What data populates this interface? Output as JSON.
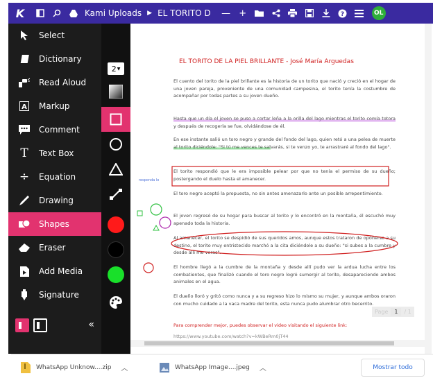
{
  "topbar": {
    "logo": "K",
    "folder": "Kami Uploads",
    "doc_title": "EL TORITO D",
    "avatar": "OL"
  },
  "sidebar": {
    "items": [
      {
        "label": "Select",
        "icon": "cursor-icon"
      },
      {
        "label": "Dictionary",
        "icon": "book-icon"
      },
      {
        "label": "Read Aloud",
        "icon": "read-aloud-icon"
      },
      {
        "label": "Markup",
        "icon": "markup-icon"
      },
      {
        "label": "Comment",
        "icon": "comment-icon"
      },
      {
        "label": "Text Box",
        "icon": "text-box-icon"
      },
      {
        "label": "Equation",
        "icon": "equation-icon"
      },
      {
        "label": "Drawing",
        "icon": "pen-icon"
      },
      {
        "label": "Shapes",
        "icon": "shapes-icon"
      },
      {
        "label": "Eraser",
        "icon": "eraser-icon"
      },
      {
        "label": "Add Media",
        "icon": "media-icon"
      },
      {
        "label": "Signature",
        "icon": "signature-icon"
      }
    ],
    "active": "Shapes"
  },
  "palette": {
    "size_value": "2",
    "colors": [
      "#ff1a1a",
      "#000000",
      "#19e02a"
    ]
  },
  "document": {
    "heading": "EL TORITO DE LA PIEL BRILLANTE - José María Arguedas",
    "side_note": "responda lo",
    "paragraphs": [
      {
        "text": "El cuento del torito de la piel brillante es la historia de un torito que nació y creció en el hogar de una joven pareja, proveniente de una comunidad campesina, el torito tenía la costumbre de acompañar por todas partes a su joven dueño.",
        "color": "#444444"
      },
      {
        "text": "Hasta que un día el joven se puso a cortar leña a la orilla del lago mientras el torito comía totora y después de recogerla se fue, olvidándose de él.",
        "color": "#444444"
      },
      {
        "text": "En ese instante salió un toro negro y grande del fondo del lago, quien retó a una pelea de muerte al torito diciéndole: \"Si tú me vences te salvarás, si te venzo yo, te arrastraré al fondo del lago\".",
        "color": "#444444"
      },
      {
        "text": "El torito respondió que le era imposible pelear por que no tenía el permiso de su dueño; postergando el duelo hasta el amanecer.",
        "color": "#444444"
      },
      {
        "text": "El toro negro aceptó la propuesta, no sin antes amenazarlo ante un posible arrepentimiento.",
        "color": "#444444"
      },
      {
        "text": "El joven regresó de su hogar para buscar al torito y lo encontró en la montaña, él escuchó muy apenado toda la historia.",
        "color": "#444444"
      },
      {
        "text": "Al amanecer, el torito se despidió de sus queridos amos, aunque estos trataron de oponerse a su destino, el torito muy entristecido marchó a la cita diciéndole a su dueño: \"si subes a la cumbre y desde allí me veras\".",
        "color": "#444444"
      },
      {
        "text": "El hombre llegó a la cumbre de la montaña y desde allí pudo ver la ardua lucha entre los combatientes, que finalizó cuando el toro negro logró sumergir al torito, desapareciendo ambos animales en el agua.",
        "color": "#444444"
      },
      {
        "text": "El dueño lloró y gritó como nunca y a su regreso hizo lo mismo su mujer, y aunque ambos oraron con mucho cuidado a la vaca madre del torito, esta nunca pudo alumbrar otro becerrito.",
        "color": "#444444"
      },
      {
        "text": "Para comprender mejor, puedes observar el video visitando el siguiente link:",
        "color": "#d02020"
      },
      {
        "text": "https://www.youtube.com/watch?v=kWBeRm0jT44",
        "color": "#888888"
      }
    ]
  },
  "pager": {
    "label": "Page",
    "current": "1",
    "total": "/ 1"
  },
  "downloads": [
    {
      "name": "WhatsApp Unknow....zip",
      "icon": "zip-file-icon"
    },
    {
      "name": "WhatsApp Image....jpeg",
      "icon": "image-file-icon"
    }
  ],
  "show_all": "Mostrar todo"
}
